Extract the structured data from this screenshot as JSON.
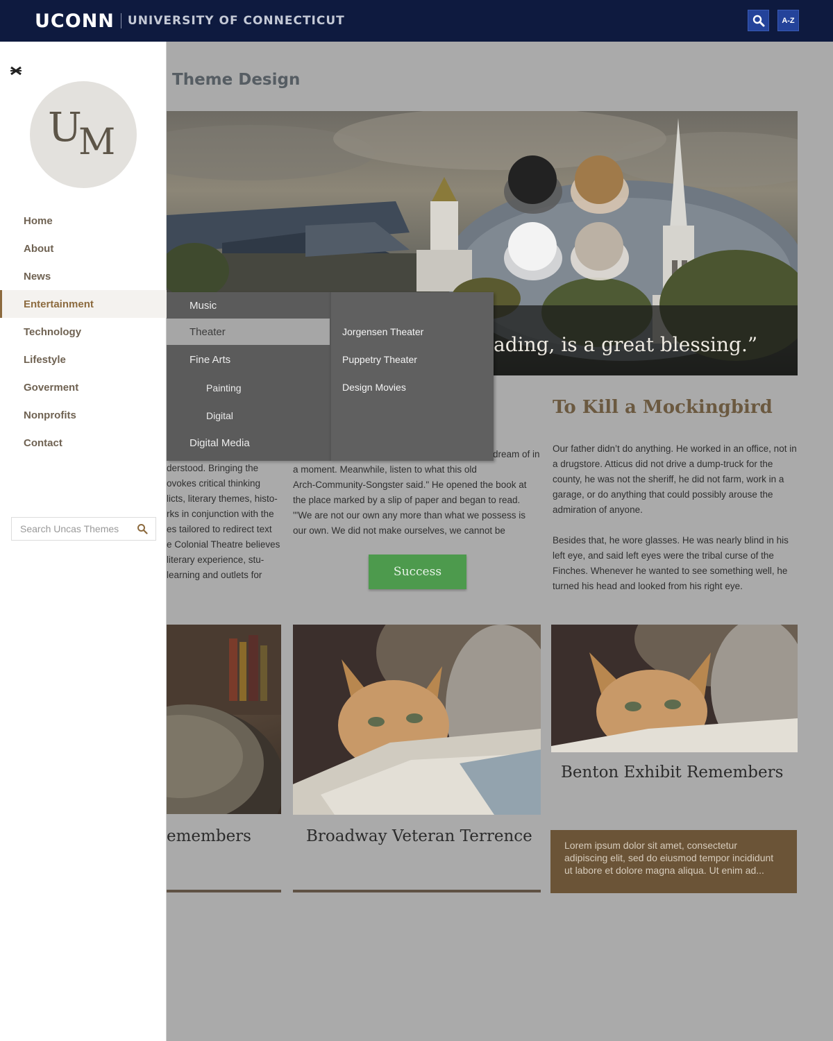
{
  "header": {
    "logo": "UCONN",
    "university": "UNIVERSITY OF CONNECTICUT",
    "search_icon": "search-icon",
    "az_label": "A-Z"
  },
  "sidebar": {
    "close_icon": "close-icon",
    "logo_u": "U",
    "logo_m": "M",
    "items": [
      {
        "label": "Home"
      },
      {
        "label": "About"
      },
      {
        "label": "News"
      },
      {
        "label": "Entertainment"
      },
      {
        "label": "Technology"
      },
      {
        "label": "Lifestyle"
      },
      {
        "label": "Goverment"
      },
      {
        "label": "Nonprofits"
      },
      {
        "label": "Contact"
      }
    ],
    "active_item": "Entertainment",
    "search": {
      "placeholder": "Search Uncas Themes",
      "value": ""
    }
  },
  "submenu": {
    "items": [
      {
        "label": "Music"
      },
      {
        "label": "Theater"
      },
      {
        "label": "Fine Arts"
      },
      {
        "label": "Painting"
      },
      {
        "label": "Digital"
      },
      {
        "label": "Digital Media"
      }
    ],
    "highlighted": "Theater",
    "theater_items": [
      {
        "label": "Jorgensen Theater"
      },
      {
        "label": "Puppetry Theater"
      },
      {
        "label": "Design Movies"
      }
    ]
  },
  "main": {
    "title": "Theme Design",
    "hero_quote": "ading, is a great blessing.”",
    "swatches": [
      "#222222",
      "#a07a4a",
      "#f3f3f3",
      "#bbb1a4"
    ],
    "col1": {
      "lines": [
        "derstood. Bringing the",
        "ovokes critical thinking",
        "licts, literary themes, histo-",
        "rks in conjunction with the",
        "es tailored to redirect text",
        "e Colonial Theatre believes",
        "literary experience, stu-",
        " learning and outlets for"
      ]
    },
    "col2": {
      "lines": [
        "dream of in",
        "a moment. Meanwhile, listen to what this old",
        "Arch-Community-Songster said.\" He opened the book at",
        "the place marked by a slip of paper and began to read.",
        "\"'We are not our own any more than what we possess is",
        "our own. We did not make ourselves, we cannot be"
      ],
      "button": "Success"
    },
    "col3": {
      "title": "To Kill a Mockingbird",
      "para1": "Our father didn’t do anything. He worked in an office, not in a drugstore. Atticus did not drive a dump-truck for the county, he was not the sheriff, he did not farm, work in a garage, or do anything that could possibly arouse the admiration of anyone.",
      "para2": "Besides that, he wore glasses. He was nearly blind in his left eye, and said left eyes were the tribal curse of the Finches. Whenever he wanted to see something well, he turned his head and looked from his right eye."
    },
    "cards": [
      {
        "title": "emembers"
      },
      {
        "title": "Broadway Veteran Terrence"
      },
      {
        "title": "Benton Exhibit Remembers",
        "excerpt": "Lorem ipsum dolor sit amet, consectetur adipiscing elit, sed do eiusmod tempor incididunt ut labore et dolore magna aliqua. Ut enim ad..."
      }
    ]
  },
  "colors": {
    "topbar": "#0e1a3f",
    "accent": "#8c6a3e",
    "success": "#4d9a4d",
    "card_box": "#6b5437"
  }
}
